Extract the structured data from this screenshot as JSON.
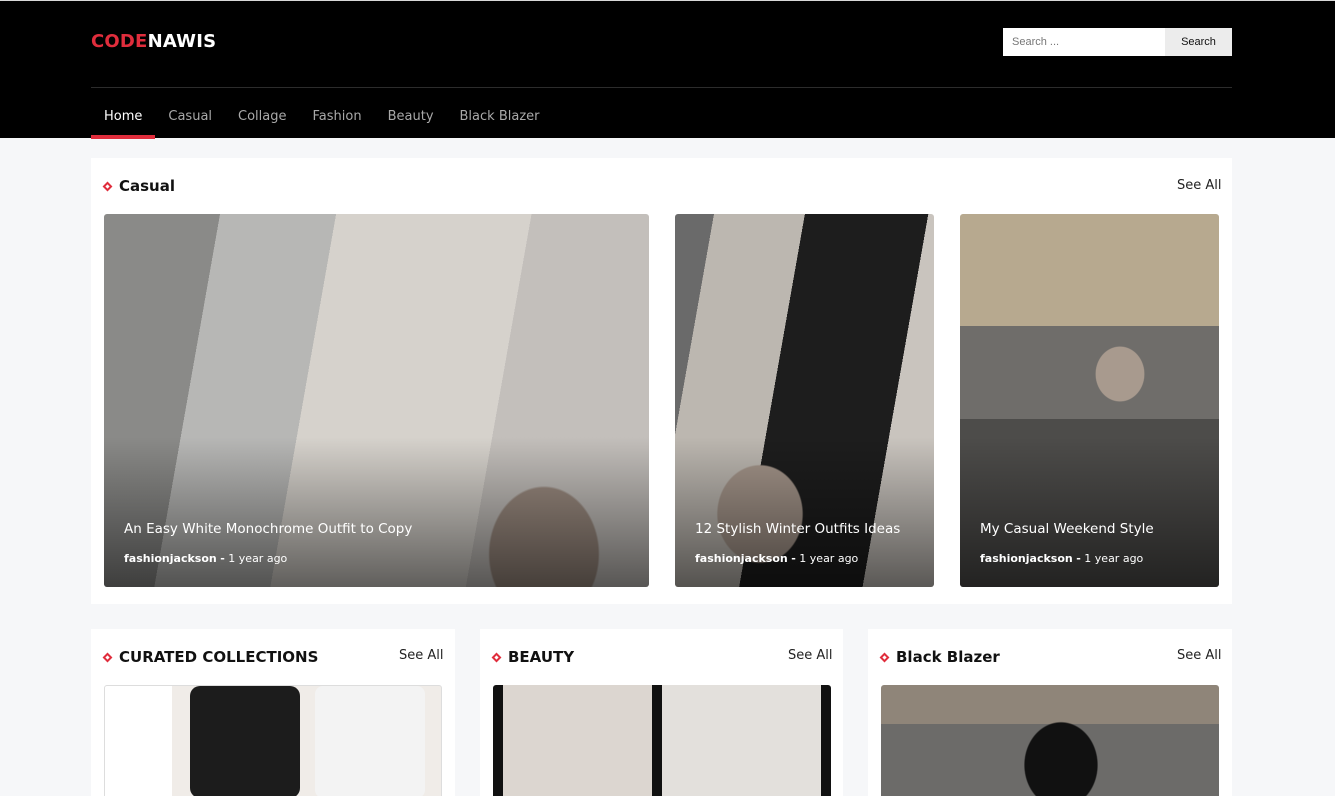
{
  "site": {
    "logo_part1": "CODE",
    "logo_part2": "NAWIS",
    "accent_color": "#e02d3c"
  },
  "search": {
    "placeholder": "Search ...",
    "button_label": "Search"
  },
  "nav": {
    "items": [
      {
        "label": "Home",
        "active": true
      },
      {
        "label": "Casual",
        "active": false
      },
      {
        "label": "Collage",
        "active": false
      },
      {
        "label": "Fashion",
        "active": false
      },
      {
        "label": "Beauty",
        "active": false
      },
      {
        "label": "Black Blazer",
        "active": false
      }
    ]
  },
  "casual": {
    "title": "Casual",
    "see_all": "See All",
    "posts": [
      {
        "title": "An Easy White Monochrome Outfit to Copy",
        "author": "fashionjackson",
        "separator": "-",
        "time": "1 year ago"
      },
      {
        "title": "12 Stylish Winter Outfits Ideas",
        "author": "fashionjackson",
        "separator": "-",
        "time": "1 year ago"
      },
      {
        "title": "My Casual Weekend Style",
        "author": "fashionjackson",
        "separator": "-",
        "time": "1 year ago"
      }
    ]
  },
  "sections": [
    {
      "title": "CURATED COLLECTIONS",
      "see_all": "See All"
    },
    {
      "title": "BEAUTY",
      "see_all": "See All"
    },
    {
      "title": "Black Blazer",
      "see_all": "See All"
    }
  ]
}
